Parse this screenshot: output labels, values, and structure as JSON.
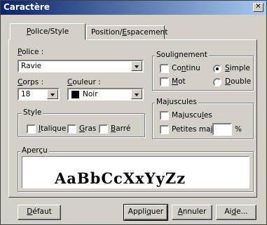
{
  "window": {
    "title": "Caractère",
    "close_glyph": "✕"
  },
  "tabs": [
    {
      "label_pre": "",
      "label_u": "P",
      "label_post": "olice/Style"
    },
    {
      "label_pre": "Position/",
      "label_u": "E",
      "label_post": "spacement"
    }
  ],
  "police": {
    "label_u": "P",
    "label_rest": "olice :",
    "value": "Ravie"
  },
  "corps": {
    "label_u": "C",
    "label_rest": "orps :",
    "value": "18"
  },
  "couleur": {
    "label_u": "C",
    "label_rest": "ouleur :",
    "value": "Noir",
    "swatch_color": "#000000"
  },
  "style": {
    "legend": "Style",
    "italique": {
      "u": "I",
      "rest": "talique"
    },
    "gras": {
      "u": "G",
      "rest": "ras"
    },
    "barre": {
      "u": "B",
      "rest": "arré"
    }
  },
  "soulignement": {
    "legend": "Soulignement",
    "continu": {
      "pre": "Co",
      "u": "n",
      "post": "tinu"
    },
    "mot": {
      "u": "M",
      "post": "ot"
    },
    "simple": {
      "u": "S",
      "post": "imple"
    },
    "double": {
      "u": "D",
      "post": "ouble"
    }
  },
  "majuscules": {
    "legend": "Majuscules",
    "majuscules": {
      "pre": "Majuscu",
      "u": "l",
      "post": "es"
    },
    "petites": {
      "pre": "Petites maj.:",
      "suffix": "%"
    }
  },
  "apercu": {
    "legend": "Aperçu",
    "sample": "AaBbCcXxYyZz"
  },
  "buttons": {
    "defaut": {
      "u": "D",
      "rest": "éfaut"
    },
    "appliquer": {
      "pre": "Appli",
      "u": "q",
      "post": "uer"
    },
    "annuler": {
      "u": "A",
      "rest": "nnuler"
    },
    "aide": {
      "pre": "Ai",
      "u": "d",
      "post": "e..."
    }
  }
}
